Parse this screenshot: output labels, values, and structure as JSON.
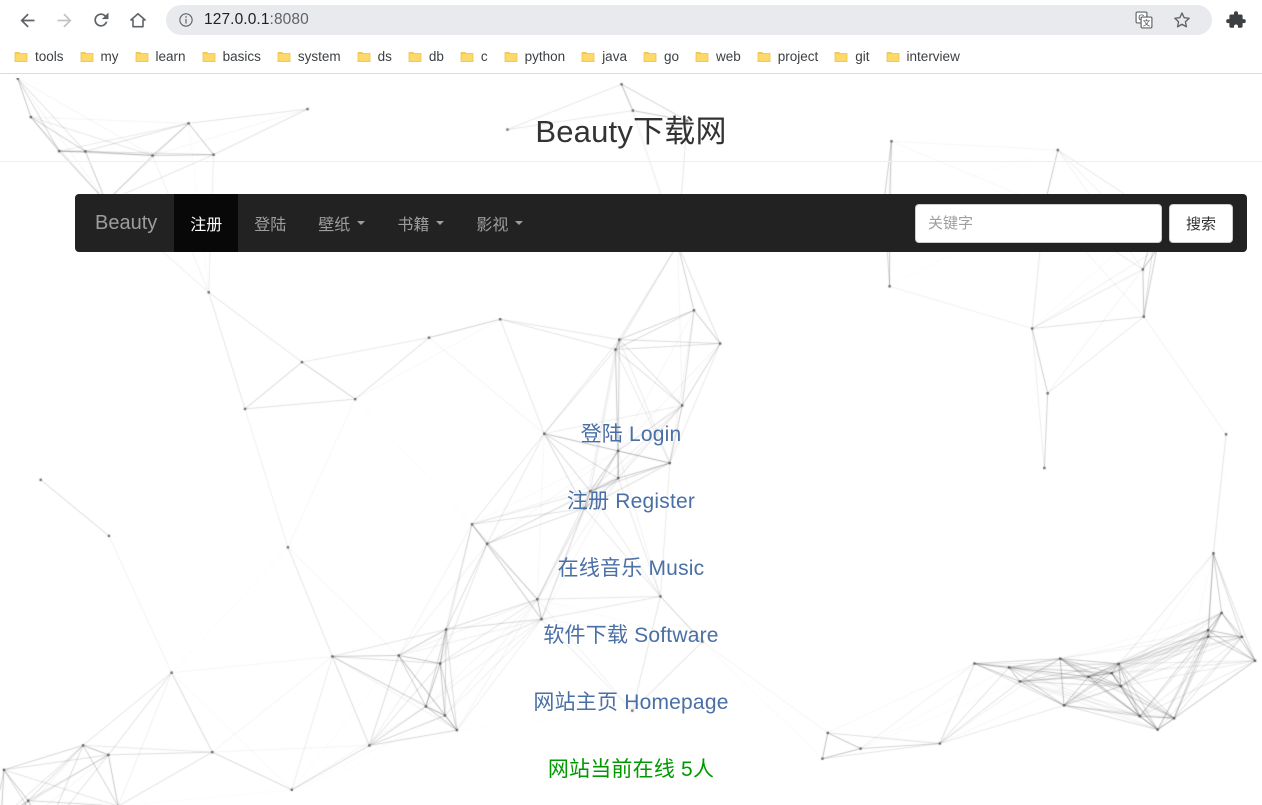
{
  "browser": {
    "back_label": "Back",
    "forward_label": "Forward",
    "reload_label": "Reload",
    "home_label": "Home",
    "url_host": "127.0.0.1",
    "url_port": ":8080",
    "site_info_icon": "info-circle-icon",
    "translate_icon": "translate-icon",
    "star_icon": "star-outline-icon",
    "extensions_icon": "puzzle-piece-icon",
    "bookmarks": [
      {
        "label": "tools"
      },
      {
        "label": "my"
      },
      {
        "label": "learn"
      },
      {
        "label": "basics"
      },
      {
        "label": "system"
      },
      {
        "label": "ds"
      },
      {
        "label": "db"
      },
      {
        "label": "c"
      },
      {
        "label": "python"
      },
      {
        "label": "java"
      },
      {
        "label": "go"
      },
      {
        "label": "web"
      },
      {
        "label": "project"
      },
      {
        "label": "git"
      },
      {
        "label": "interview"
      }
    ]
  },
  "page": {
    "title": "Beauty下载网",
    "navbar": {
      "brand": "Beauty",
      "items": [
        {
          "label": "注册",
          "active": true,
          "caret": false
        },
        {
          "label": "登陆",
          "active": false,
          "caret": false
        },
        {
          "label": "壁纸",
          "active": false,
          "caret": true
        },
        {
          "label": "书籍",
          "active": false,
          "caret": true
        },
        {
          "label": "影视",
          "active": false,
          "caret": true
        }
      ],
      "search_placeholder": "关键字",
      "search_value": "",
      "search_button": "搜索"
    },
    "links": [
      {
        "label": "登陆 Login"
      },
      {
        "label": "注册 Register"
      },
      {
        "label": "在线音乐 Music"
      },
      {
        "label": "软件下载 Software"
      },
      {
        "label": "网站主页 Homepage"
      }
    ],
    "online_status": "网站当前在线 5人",
    "colors": {
      "link": "#4a6fa5",
      "online": "#009900",
      "navbar_bg": "#222222",
      "navbar_active_bg": "#080808",
      "brand_text": "#9d9d9d"
    }
  }
}
